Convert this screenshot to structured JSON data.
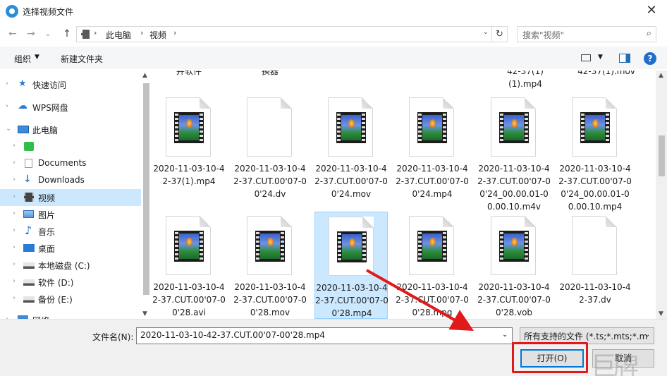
{
  "window": {
    "title": "选择视频文件",
    "close": "✕"
  },
  "nav": {
    "back": "←",
    "forward": "→",
    "recent": "⌄",
    "up": "↑",
    "crumbs": [
      "此电脑",
      "视频"
    ],
    "sep": "›",
    "refresh": "↻",
    "search_placeholder": "搜索\"视频\""
  },
  "toolbar": {
    "organize": "组织",
    "new_folder": "新建文件夹",
    "help": "?"
  },
  "sidebar": {
    "items": [
      {
        "label": "快速访问",
        "icon": "star-icon"
      },
      {
        "label": "WPS网盘",
        "icon": "cloud-icon"
      },
      {
        "label": "此电脑",
        "icon": "computer-icon"
      },
      {
        "label": "",
        "icon": "wps-app-icon"
      },
      {
        "label": "Documents",
        "icon": "document-icon"
      },
      {
        "label": "Downloads",
        "icon": "download-icon"
      },
      {
        "label": "视频",
        "icon": "video-folder-icon"
      },
      {
        "label": "图片",
        "icon": "picture-icon"
      },
      {
        "label": "音乐",
        "icon": "music-icon"
      },
      {
        "label": "桌面",
        "icon": "desktop-icon"
      },
      {
        "label": "本地磁盘 (C:)",
        "icon": "drive-c-icon"
      },
      {
        "label": "软件 (D:)",
        "icon": "drive-icon"
      },
      {
        "label": "备份 (E:)",
        "icon": "drive-icon"
      },
      {
        "label": "网络",
        "icon": "network-icon"
      }
    ]
  },
  "top_partial": [
    "并软件",
    "换器",
    "42-37(1)\n(1).mp4",
    "42-37(1).mov"
  ],
  "files": [
    {
      "name": "2020-11-03-10-42-37(1).mp4",
      "video": true
    },
    {
      "name": "2020-11-03-10-42-37.CUT.00'07-00'24.dv",
      "video": false
    },
    {
      "name": "2020-11-03-10-42-37.CUT.00'07-00'24.mov",
      "video": true
    },
    {
      "name": "2020-11-03-10-42-37.CUT.00'07-00'24.mp4",
      "video": true
    },
    {
      "name": "2020-11-03-10-42-37.CUT.00'07-00'24_00.00.01-00.00.10.m4v",
      "video": true
    },
    {
      "name": "2020-11-03-10-42-37.CUT.00'07-00'24_00.00.01-00.00.10.mp4",
      "video": true
    },
    {
      "name": "2020-11-03-10-42-37.CUT.00'07-00'28.avi",
      "video": true
    },
    {
      "name": "2020-11-03-10-42-37.CUT.00'07-00'28.mov",
      "video": true
    },
    {
      "name": "2020-11-03-10-42-37.CUT.00'07-00'28.mp4",
      "video": true,
      "selected": true
    },
    {
      "name": "2020-11-03-10-42-37.CUT.00'07-00'28.mpg",
      "video": true
    },
    {
      "name": "2020-11-03-10-42-37.CUT.00'07-00'28.vob",
      "video": true
    },
    {
      "name": "2020-11-03-10-42-37.dv",
      "video": false
    }
  ],
  "bottom": {
    "filename_label": "文件名(N):",
    "filename_value": "2020-11-03-10-42-37.CUT.00'07-00'28.mp4",
    "filetype_value": "所有支持的文件 (*.ts;*.mts;*.m",
    "open": "打开(O)",
    "cancel": "取消",
    "watermark": "巨牌"
  },
  "colors": {
    "accent": "#0078d7",
    "selected_bg": "#cce8ff",
    "annotation": "#e0191b"
  }
}
